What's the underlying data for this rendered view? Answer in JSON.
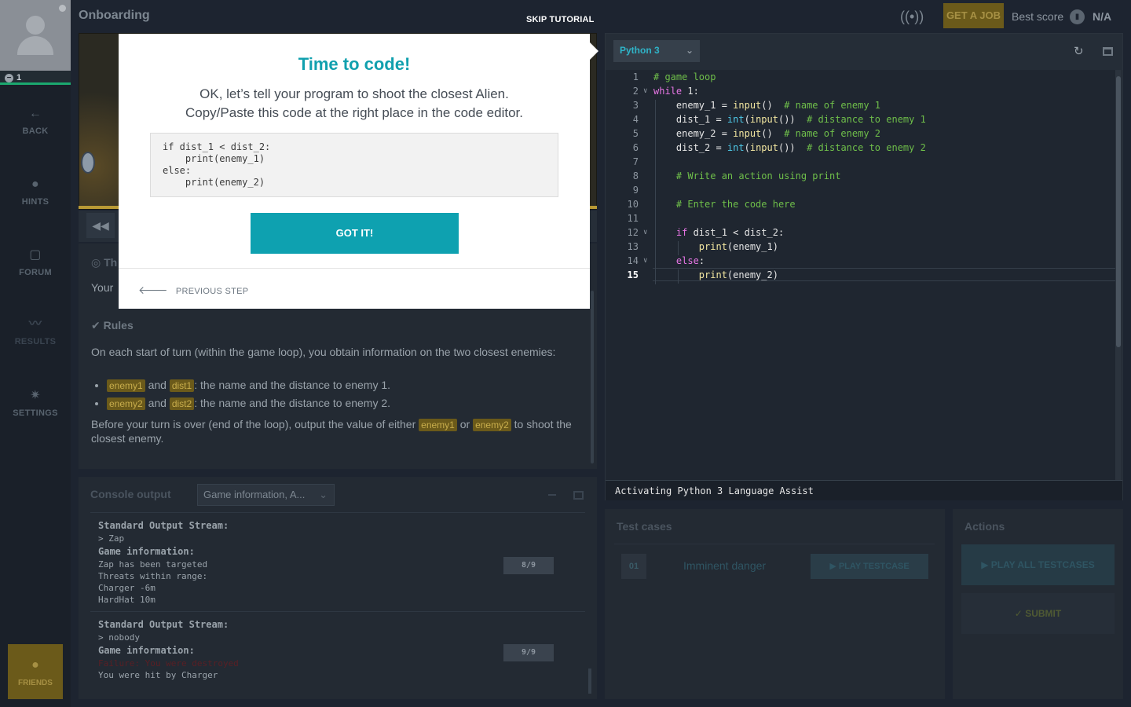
{
  "sidebar": {
    "level": "1",
    "items": [
      {
        "label": "BACK",
        "icon": "arrow-left-icon"
      },
      {
        "label": "HINTS",
        "icon": "lightbulb-icon"
      },
      {
        "label": "FORUM",
        "icon": "forum-icon"
      },
      {
        "label": "RESULTS",
        "icon": "chart-line-icon"
      },
      {
        "label": "SETTINGS",
        "icon": "gear-icon"
      }
    ],
    "friends_label": "FRIENDS"
  },
  "topbar": {
    "title": "Onboarding",
    "skip_label": "SKIP TUTORIAL",
    "get_job_label": "GET A JOB",
    "best_score_label": "Best score",
    "rank": "N/A"
  },
  "statement": {
    "goal_prefix": "Your",
    "rules_title": "Rules",
    "rules_intro": "On each start of turn (within the game loop), you obtain information on the two closest enemies:",
    "rule_items": [
      {
        "kw1": "enemy1",
        "and": "and",
        "kw2": "dist1",
        "text": ": the name and the distance to enemy 1."
      },
      {
        "kw1": "enemy2",
        "and": "and",
        "kw2": "dist2",
        "text": ": the name and the distance to enemy 2."
      }
    ],
    "output_before": "Before your turn is over (end of the loop), output the value of either",
    "output_kw1": "enemy1",
    "output_or": "or",
    "output_kw2": "enemy2",
    "output_after": "to shoot the closest enemy."
  },
  "console": {
    "title": "Console output",
    "filter_value": "Game information, A...",
    "frames": [
      {
        "stdout_label": "Standard Output Stream:",
        "stdout": "> Zap",
        "info_label": "Game information:",
        "lines": [
          "Zap has been targeted",
          "Threats within range:",
          "Charger -6m",
          "HardHat 10m"
        ],
        "badge": "8/9"
      },
      {
        "stdout_label": "Standard Output Stream:",
        "stdout": "> nobody",
        "info_label": "Game information:",
        "error": "Failure: You were destroyed",
        "lines": [
          "You were hit by Charger"
        ],
        "badge": "9/9"
      }
    ]
  },
  "editor": {
    "language": "Python 3",
    "status": "Activating Python 3 Language Assist",
    "current_line": "15",
    "line_numbers": [
      "1",
      "2",
      "3",
      "4",
      "5",
      "6",
      "7",
      "8",
      "9",
      "10",
      "11",
      "12",
      "13",
      "14",
      "15"
    ]
  },
  "testcases": {
    "title": "Test cases",
    "items": [
      {
        "num": "01",
        "name": "Imminent danger",
        "play_label": "PLAY TESTCASE"
      }
    ]
  },
  "actions": {
    "title": "Actions",
    "play_all_label": "PLAY ALL TESTCASES",
    "submit_label": "SUBMIT"
  },
  "modal": {
    "title": "Time to code!",
    "text_line1": "OK, let’s tell your program to shoot the closest Alien.",
    "text_line2": "Copy/Paste this code at the right place in the code editor.",
    "code": "if dist_1 < dist_2:\n    print(enemy_1)\nelse:\n    print(enemy_2)",
    "button_label": "GOT IT!",
    "prev_label": "PREVIOUS STEP"
  },
  "colors": {
    "accent": "#0ea1b0",
    "gold": "#6b5a1a",
    "success": "#1ba86f"
  }
}
